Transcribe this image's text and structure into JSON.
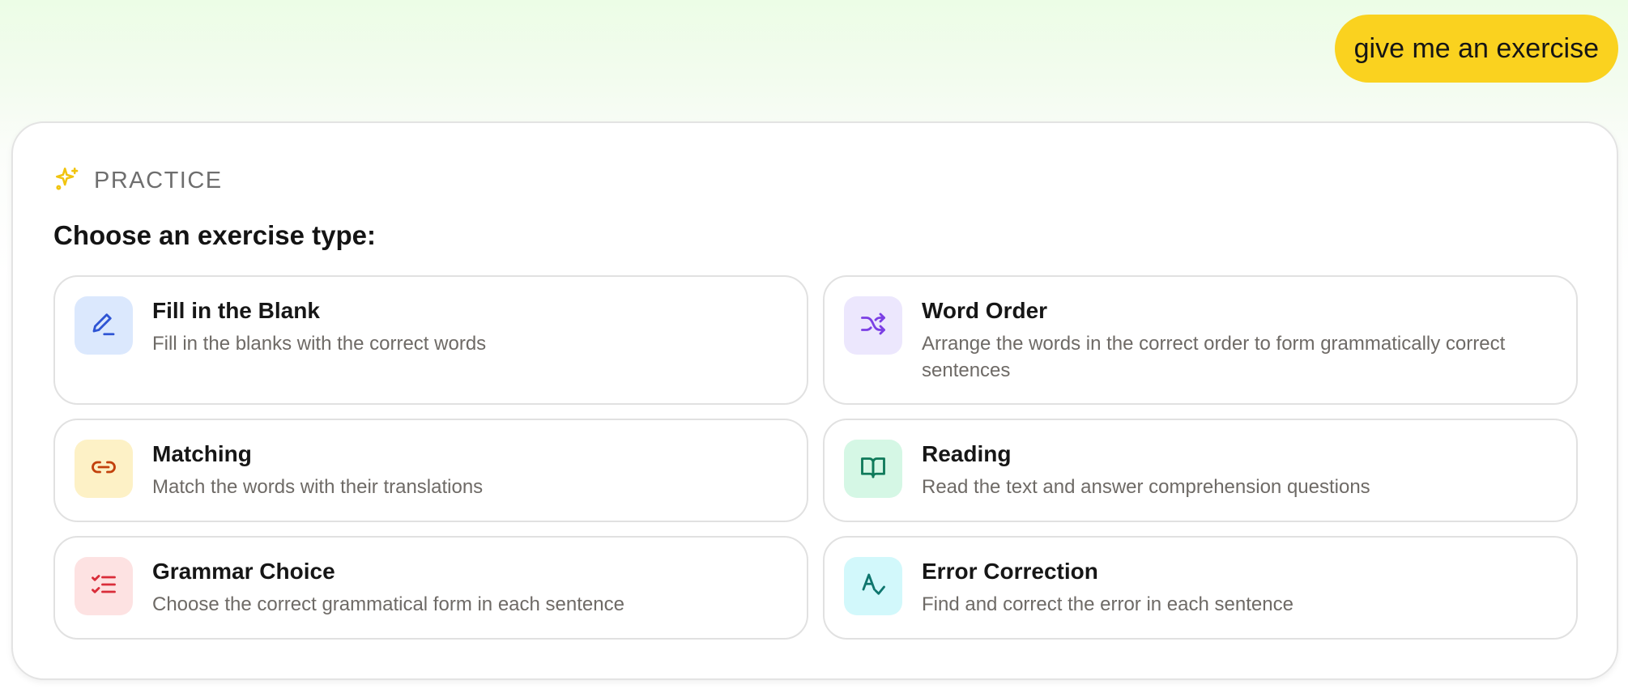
{
  "user_message": "give me an exercise",
  "practice": {
    "label": "PRACTICE",
    "title": "Choose an exercise type:",
    "options": [
      {
        "title": "Fill in the Blank",
        "description": "Fill in the blanks with the correct words",
        "icon": "pencil-icon",
        "icon_bg": "#dbe8fd",
        "icon_color": "#2f55d4"
      },
      {
        "title": "Word Order",
        "description": "Arrange the words in the correct order to form grammatically correct sentences",
        "icon": "shuffle-icon",
        "icon_bg": "#ece7fd",
        "icon_color": "#7b3fe4"
      },
      {
        "title": "Matching",
        "description": "Match the words with their translations",
        "icon": "link-icon",
        "icon_bg": "#fdf1c6",
        "icon_color": "#c2410c"
      },
      {
        "title": "Reading",
        "description": "Read the text and answer comprehension questions",
        "icon": "book-icon",
        "icon_bg": "#d5f7e5",
        "icon_color": "#0f7a5a"
      },
      {
        "title": "Grammar Choice",
        "description": "Choose the correct grammatical form in each sentence",
        "icon": "checklist-icon",
        "icon_bg": "#fde2e2",
        "icon_color": "#d92d3a"
      },
      {
        "title": "Error Correction",
        "description": "Find and correct the error in each sentence",
        "icon": "spell-check-icon",
        "icon_bg": "#d2f8fb",
        "icon_color": "#0f766e"
      }
    ]
  },
  "colors": {
    "accent": "#fad21f",
    "sparkle": "#f1c40f"
  }
}
